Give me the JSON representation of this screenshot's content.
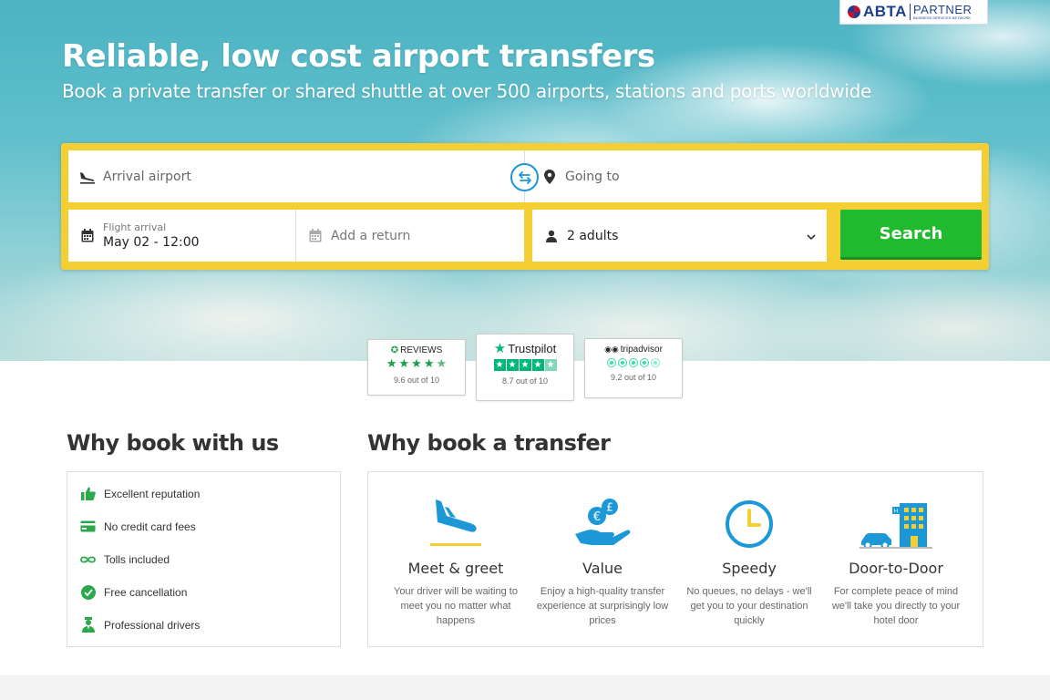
{
  "badge": {
    "brand": "ABTA",
    "partner": "PARTNER",
    "partner_sub": "BUSINESS SERVICES NETWORK"
  },
  "hero": {
    "title": "Reliable, low cost airport transfers",
    "subtitle": "Book a private transfer or shared shuttle at over 500 airports, stations and ports worldwide"
  },
  "search": {
    "arrival_placeholder": "Arrival airport",
    "going_placeholder": "Going to",
    "flight_label": "Flight arrival",
    "flight_value": "May 02 - 12:00",
    "return_placeholder": "Add a return",
    "passengers_value": "2 adults",
    "button_label": "Search"
  },
  "reviews": [
    {
      "brand": "REVIEWS",
      "score": "9.6 out of 10",
      "color": "#1a9e4b"
    },
    {
      "brand": "Trustpilot",
      "score": "8.7 out of 10",
      "color": "#00b67a"
    },
    {
      "brand": "tripadvisor",
      "score": "9.2 out of 10",
      "color": "#34e0a1"
    }
  ],
  "why_book": {
    "title": "Why book with us",
    "items": [
      {
        "label": "Excellent reputation",
        "icon": "thumbs-up-icon"
      },
      {
        "label": "No credit card fees",
        "icon": "credit-card-icon"
      },
      {
        "label": "Tolls included",
        "icon": "infinity-icon"
      },
      {
        "label": "Free cancellation",
        "icon": "check-circle-icon"
      },
      {
        "label": "Professional drivers",
        "icon": "driver-icon"
      }
    ]
  },
  "why_transfer": {
    "title": "Why book a transfer",
    "features": [
      {
        "title": "Meet & greet",
        "desc": "Your driver will be waiting to meet you no matter what happens",
        "icon": "plane-landing-icon"
      },
      {
        "title": "Value",
        "desc": "Enjoy a high-quality transfer experience at surprisingly low prices",
        "icon": "coins-hand-icon"
      },
      {
        "title": "Speedy",
        "desc": "No queues, no delays - we'll get you to your destination quickly",
        "icon": "clock-icon"
      },
      {
        "title": "Door-to-Door",
        "desc": "For complete peace of mind we'll take you directly to your hotel door",
        "icon": "car-hotel-icon"
      }
    ]
  },
  "colors": {
    "accent_yellow": "#f4cf33",
    "search_green": "#1fba2e",
    "icon_blue": "#1c98d6",
    "icon_green": "#2aa84a"
  }
}
